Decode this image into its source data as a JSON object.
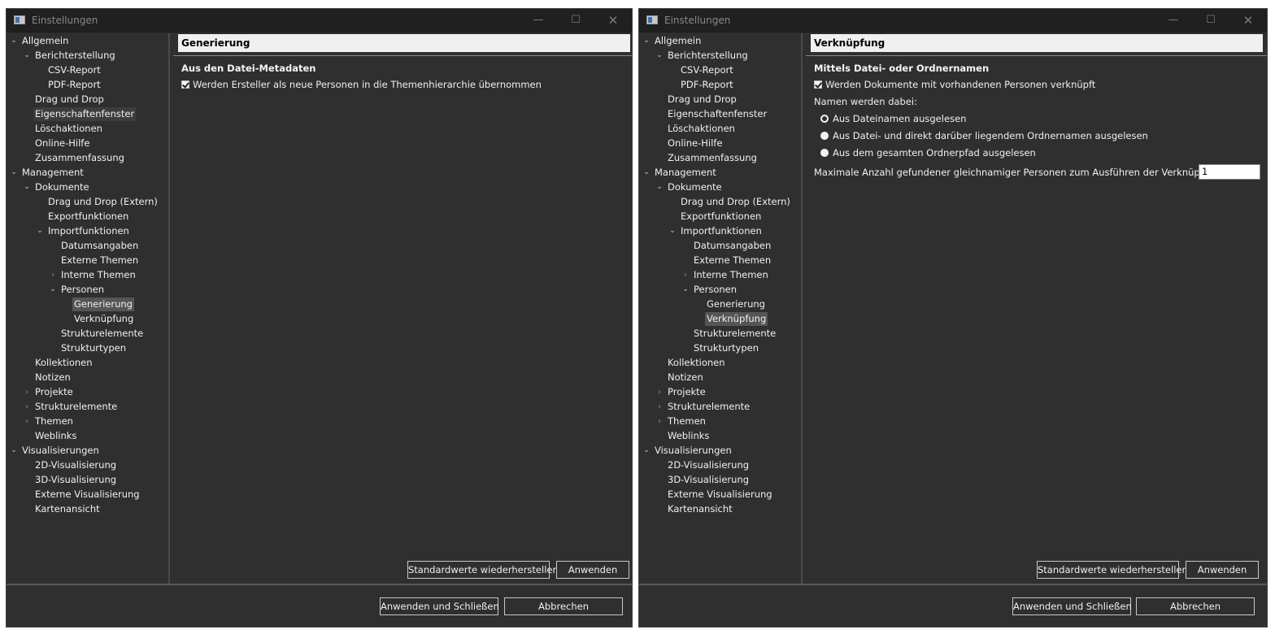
{
  "windows": [
    {
      "title": "Einstellungen",
      "controls": {
        "minimize": "—",
        "maximize": "☐",
        "close": "✕"
      },
      "tree": [
        {
          "label": "Allgemein",
          "depth": 0,
          "twisty": "open"
        },
        {
          "label": "Berichterstellung",
          "depth": 1,
          "twisty": "open"
        },
        {
          "label": "CSV-Report",
          "depth": 2,
          "twisty": "none"
        },
        {
          "label": "PDF-Report",
          "depth": 2,
          "twisty": "none"
        },
        {
          "label": "Drag und Drop",
          "depth": 1,
          "twisty": "none"
        },
        {
          "label": "Eigenschaftenfenster",
          "depth": 1,
          "twisty": "none",
          "state": "hover"
        },
        {
          "label": "Löschaktionen",
          "depth": 1,
          "twisty": "none"
        },
        {
          "label": "Online-Hilfe",
          "depth": 1,
          "twisty": "none"
        },
        {
          "label": "Zusammenfassung",
          "depth": 1,
          "twisty": "none"
        },
        {
          "label": "Management",
          "depth": 0,
          "twisty": "open"
        },
        {
          "label": "Dokumente",
          "depth": 1,
          "twisty": "open"
        },
        {
          "label": "Drag und Drop (Extern)",
          "depth": 2,
          "twisty": "none"
        },
        {
          "label": "Exportfunktionen",
          "depth": 2,
          "twisty": "none"
        },
        {
          "label": "Importfunktionen",
          "depth": 2,
          "twisty": "open"
        },
        {
          "label": "Datumsangaben",
          "depth": 3,
          "twisty": "none"
        },
        {
          "label": "Externe Themen",
          "depth": 3,
          "twisty": "none"
        },
        {
          "label": "Interne Themen",
          "depth": 3,
          "twisty": "closed"
        },
        {
          "label": "Personen",
          "depth": 3,
          "twisty": "open"
        },
        {
          "label": "Generierung",
          "depth": 4,
          "twisty": "none",
          "state": "selected"
        },
        {
          "label": "Verknüpfung",
          "depth": 4,
          "twisty": "none"
        },
        {
          "label": "Strukturelemente",
          "depth": 3,
          "twisty": "none"
        },
        {
          "label": "Strukturtypen",
          "depth": 3,
          "twisty": "none"
        },
        {
          "label": "Kollektionen",
          "depth": 1,
          "twisty": "none"
        },
        {
          "label": "Notizen",
          "depth": 1,
          "twisty": "none"
        },
        {
          "label": "Projekte",
          "depth": 1,
          "twisty": "closed"
        },
        {
          "label": "Strukturelemente",
          "depth": 1,
          "twisty": "closed"
        },
        {
          "label": "Themen",
          "depth": 1,
          "twisty": "closed"
        },
        {
          "label": "Weblinks",
          "depth": 1,
          "twisty": "none"
        },
        {
          "label": "Visualisierungen",
          "depth": 0,
          "twisty": "open"
        },
        {
          "label": "2D-Visualisierung",
          "depth": 1,
          "twisty": "none"
        },
        {
          "label": "3D-Visualisierung",
          "depth": 1,
          "twisty": "none"
        },
        {
          "label": "Externe Visualisierung",
          "depth": 1,
          "twisty": "none"
        },
        {
          "label": "Kartenansicht",
          "depth": 1,
          "twisty": "none"
        }
      ],
      "page": {
        "header": "Generierung",
        "section_title": "Aus den Datei-Metadaten",
        "checkbox_label": "Werden Ersteller als neue Personen in die Themenhierarchie übernommen",
        "checkbox_checked": true
      },
      "buttons": {
        "restore_defaults": "Standardwerte wiederherstellen",
        "apply": "Anwenden",
        "apply_and_close": "Anwenden und Schließen",
        "cancel": "Abbrechen"
      }
    },
    {
      "title": "Einstellungen",
      "controls": {
        "minimize": "—",
        "maximize": "☐",
        "close": "✕"
      },
      "tree": [
        {
          "label": "Allgemein",
          "depth": 0,
          "twisty": "open"
        },
        {
          "label": "Berichterstellung",
          "depth": 1,
          "twisty": "open"
        },
        {
          "label": "CSV-Report",
          "depth": 2,
          "twisty": "none"
        },
        {
          "label": "PDF-Report",
          "depth": 2,
          "twisty": "none"
        },
        {
          "label": "Drag und Drop",
          "depth": 1,
          "twisty": "none"
        },
        {
          "label": "Eigenschaftenfenster",
          "depth": 1,
          "twisty": "none"
        },
        {
          "label": "Löschaktionen",
          "depth": 1,
          "twisty": "none"
        },
        {
          "label": "Online-Hilfe",
          "depth": 1,
          "twisty": "none"
        },
        {
          "label": "Zusammenfassung",
          "depth": 1,
          "twisty": "none"
        },
        {
          "label": "Management",
          "depth": 0,
          "twisty": "open"
        },
        {
          "label": "Dokumente",
          "depth": 1,
          "twisty": "open"
        },
        {
          "label": "Drag und Drop (Extern)",
          "depth": 2,
          "twisty": "none"
        },
        {
          "label": "Exportfunktionen",
          "depth": 2,
          "twisty": "none"
        },
        {
          "label": "Importfunktionen",
          "depth": 2,
          "twisty": "open"
        },
        {
          "label": "Datumsangaben",
          "depth": 3,
          "twisty": "none"
        },
        {
          "label": "Externe Themen",
          "depth": 3,
          "twisty": "none"
        },
        {
          "label": "Interne Themen",
          "depth": 3,
          "twisty": "closed"
        },
        {
          "label": "Personen",
          "depth": 3,
          "twisty": "open"
        },
        {
          "label": "Generierung",
          "depth": 4,
          "twisty": "none"
        },
        {
          "label": "Verknüpfung",
          "depth": 4,
          "twisty": "none",
          "state": "selected"
        },
        {
          "label": "Strukturelemente",
          "depth": 3,
          "twisty": "none"
        },
        {
          "label": "Strukturtypen",
          "depth": 3,
          "twisty": "none"
        },
        {
          "label": "Kollektionen",
          "depth": 1,
          "twisty": "none"
        },
        {
          "label": "Notizen",
          "depth": 1,
          "twisty": "none"
        },
        {
          "label": "Projekte",
          "depth": 1,
          "twisty": "closed"
        },
        {
          "label": "Strukturelemente",
          "depth": 1,
          "twisty": "closed"
        },
        {
          "label": "Themen",
          "depth": 1,
          "twisty": "closed"
        },
        {
          "label": "Weblinks",
          "depth": 1,
          "twisty": "none"
        },
        {
          "label": "Visualisierungen",
          "depth": 0,
          "twisty": "open"
        },
        {
          "label": "2D-Visualisierung",
          "depth": 1,
          "twisty": "none"
        },
        {
          "label": "3D-Visualisierung",
          "depth": 1,
          "twisty": "none"
        },
        {
          "label": "Externe Visualisierung",
          "depth": 1,
          "twisty": "none"
        },
        {
          "label": "Kartenansicht",
          "depth": 1,
          "twisty": "none"
        }
      ],
      "page": {
        "header": "Verknüpfung",
        "section_title": "Mittels Datei- oder Ordnernamen",
        "checkbox_label": "Werden Dokumente mit vorhandenen Personen verknüpft",
        "checkbox_checked": true,
        "names_label": "Namen werden dabei:",
        "radios": [
          {
            "label": "Aus Dateinamen ausgelesen",
            "checked": true
          },
          {
            "label": "Aus Datei- und direkt darüber liegendem Ordnernamen ausgelesen",
            "checked": false
          },
          {
            "label": "Aus dem gesamten Ordnerpfad ausgelesen",
            "checked": false
          }
        ],
        "max_label": "Maximale Anzahl gefundener gleichnamiger Personen zum Ausführen der Verknüpfung:",
        "max_value": "1"
      },
      "buttons": {
        "restore_defaults": "Standardwerte wiederherstellen",
        "apply": "Anwenden",
        "apply_and_close": "Anwenden und Schließen",
        "cancel": "Abbrechen"
      }
    }
  ],
  "colors": {
    "window_bg": "#2f2f2f",
    "titlebar_bg": "#202020",
    "header_bg": "#f0f0f0",
    "selected_bg": "#555555",
    "text": "#f0f0f0"
  }
}
